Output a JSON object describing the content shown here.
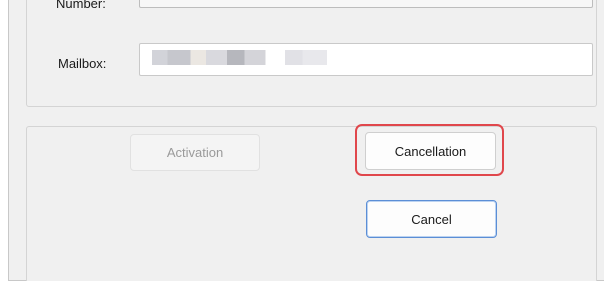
{
  "form": {
    "computer_number_label": "Compute\nNumber:",
    "mailbox_label": "Mailbox:"
  },
  "actions": {
    "activation_label": "Activation",
    "cancellation_label": "Cancellation",
    "cancel_label": "Cancel"
  },
  "colors": {
    "highlight": "#e0474c",
    "focus_border": "#5b8ed6",
    "disabled_text": "#9a9a9a"
  }
}
